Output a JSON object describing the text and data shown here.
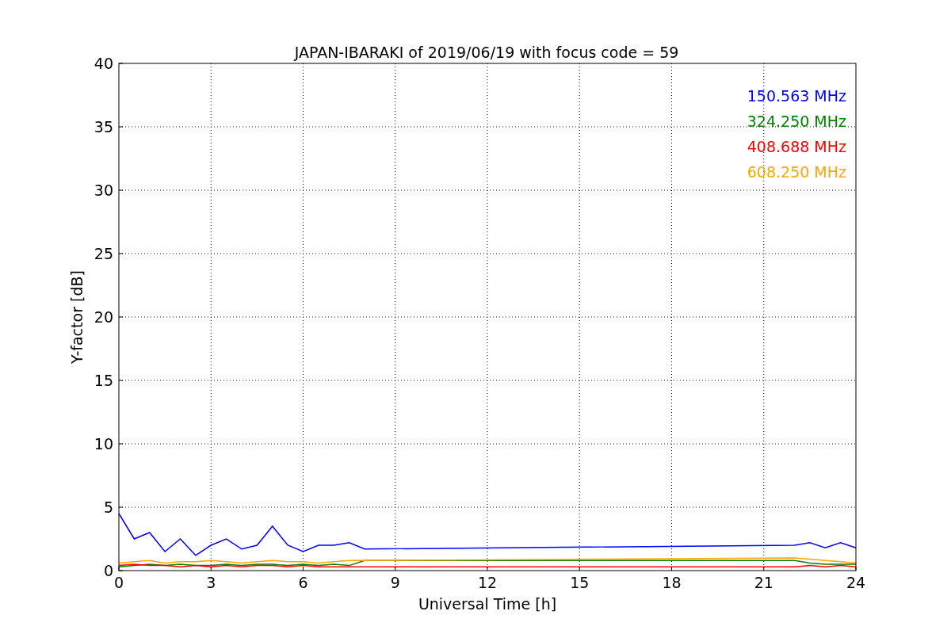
{
  "chart_data": {
    "type": "line",
    "title": "JAPAN-IBARAKI of 2019/06/19 with focus code = 59",
    "xlabel": "Universal Time [h]",
    "ylabel": "Y-factor [dB]",
    "x": [
      0,
      0.5,
      1,
      1.5,
      2,
      2.5,
      3,
      3.5,
      4,
      4.5,
      5,
      5.5,
      6,
      6.5,
      7,
      7.5,
      8,
      22,
      22.5,
      23,
      23.5,
      24
    ],
    "series": [
      {
        "name": "150.563 MHz",
        "color": "#0000ff",
        "values": [
          4.5,
          2.5,
          3,
          1.5,
          2.5,
          1.2,
          2,
          2.5,
          1.7,
          2,
          3.5,
          2,
          1.5,
          2,
          2,
          2.2,
          1.7,
          2,
          2.2,
          1.8,
          2.2,
          1.8
        ]
      },
      {
        "name": "324.250 MHz",
        "color": "#008000",
        "values": [
          0.3,
          0.4,
          0.5,
          0.4,
          0.5,
          0.4,
          0.4,
          0.5,
          0.4,
          0.5,
          0.5,
          0.4,
          0.5,
          0.4,
          0.5,
          0.4,
          0.8,
          0.8,
          0.6,
          0.5,
          0.5,
          0.5
        ]
      },
      {
        "name": "408.688 MHz",
        "color": "#ff0000",
        "values": [
          0.4,
          0.5,
          0.4,
          0.4,
          0.3,
          0.4,
          0.3,
          0.4,
          0.3,
          0.4,
          0.4,
          0.3,
          0.4,
          0.3,
          0.3,
          0.3,
          0.3,
          0.3,
          0.4,
          0.3,
          0.4,
          0.3
        ]
      },
      {
        "name": "608.250 MHz",
        "color": "#ffa500",
        "values": [
          0.6,
          0.7,
          0.8,
          0.6,
          0.7,
          0.7,
          0.8,
          0.7,
          0.6,
          0.7,
          0.8,
          0.7,
          0.7,
          0.6,
          0.7,
          0.8,
          0.8,
          1.0,
          0.9,
          0.8,
          0.7,
          0.6
        ]
      }
    ],
    "xlim": [
      0,
      24
    ],
    "ylim": [
      0,
      40
    ],
    "xticks": [
      0,
      3,
      6,
      9,
      12,
      15,
      18,
      21,
      24
    ],
    "yticks": [
      0,
      5,
      10,
      15,
      20,
      25,
      30,
      35,
      40
    ],
    "grid": true
  }
}
